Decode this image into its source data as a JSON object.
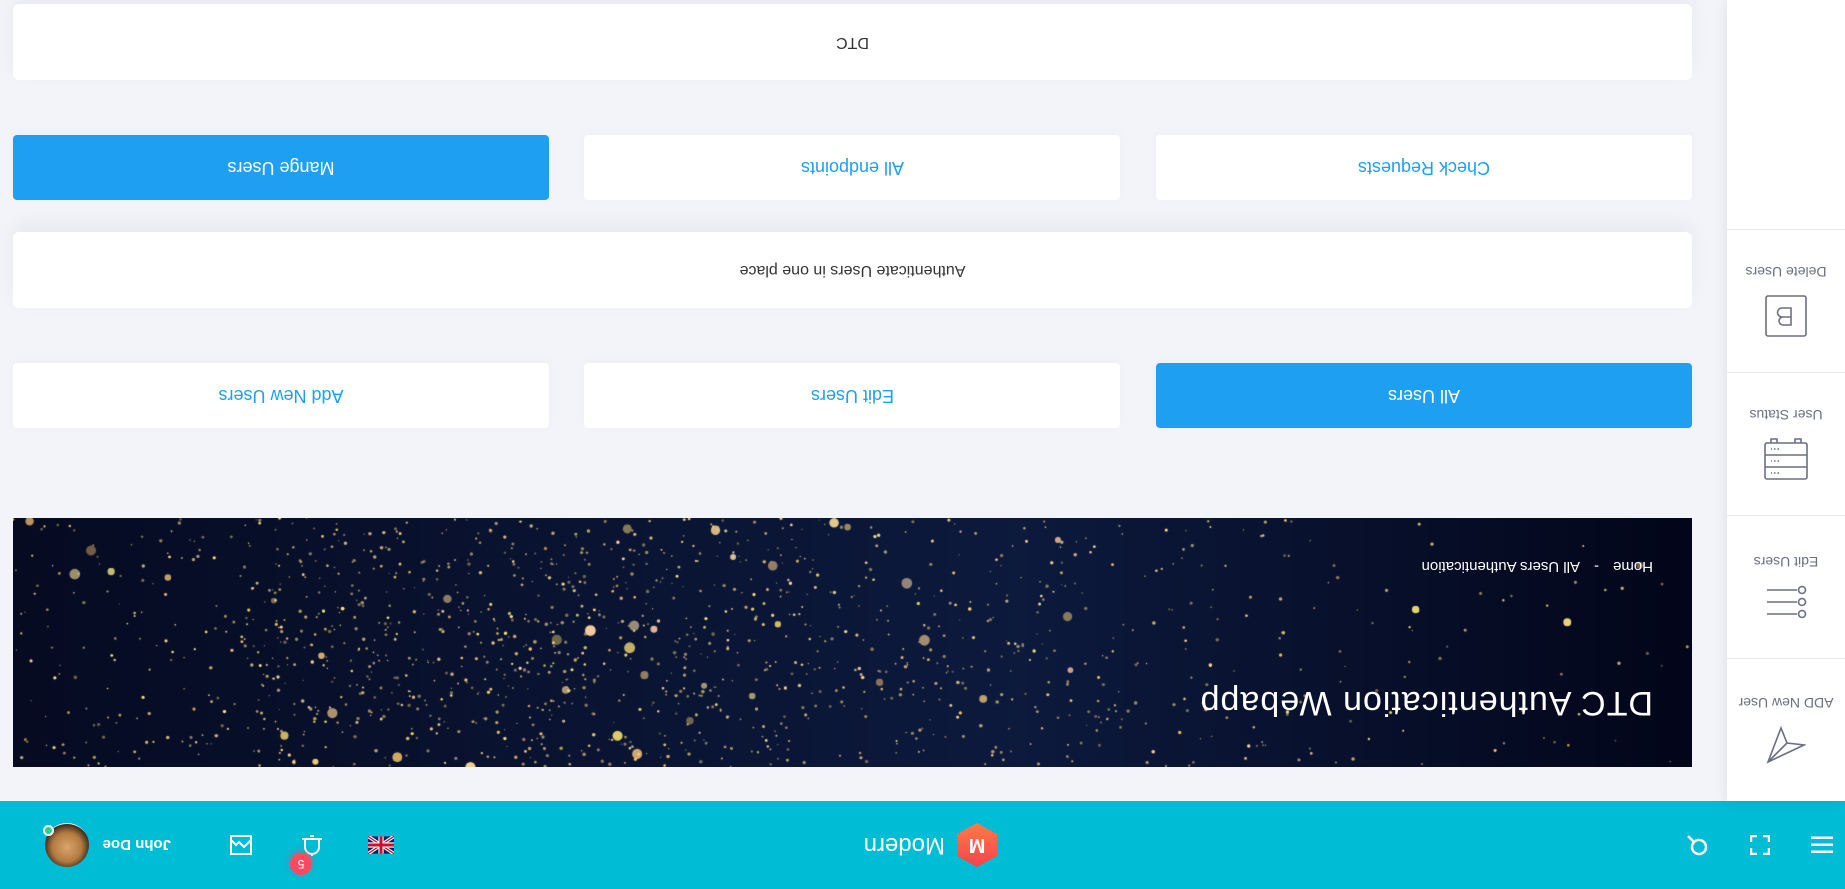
{
  "topbar": {
    "brand_name": "Modern",
    "brand_letter": "M",
    "notifications_count": "5",
    "language": "en-GB",
    "user_name": "John Doe",
    "user_status": "online",
    "color": "#00bcd4"
  },
  "sidebar": {
    "items": [
      {
        "label": "ADD New User",
        "icon": "paper-plane-icon"
      },
      {
        "label": "Edit Users",
        "icon": "list-icon"
      },
      {
        "label": "User Status",
        "icon": "server-icon"
      },
      {
        "label": "Delete Users",
        "icon": "b-box-icon"
      }
    ]
  },
  "banner": {
    "title": "DTC Authentication Webapp",
    "breadcrumb": [
      "Home",
      "-",
      "All Users Authentication"
    ]
  },
  "actions_row1": [
    {
      "label": "All Users",
      "active": true
    },
    {
      "label": "Edit Users",
      "active": false
    },
    {
      "label": "Add New Users",
      "active": false
    }
  ],
  "info_card": "Authenticate Users in one place",
  "actions_row2": [
    {
      "label": "Check Requests",
      "active": false
    },
    {
      "label": "All endpoints",
      "active": false
    },
    {
      "label": "Mange Users",
      "active": true
    }
  ],
  "footer_card": "DTC",
  "colors": {
    "primary": "#1e9ff2",
    "background": "#f3f4f9",
    "badge": "#ff4961"
  }
}
